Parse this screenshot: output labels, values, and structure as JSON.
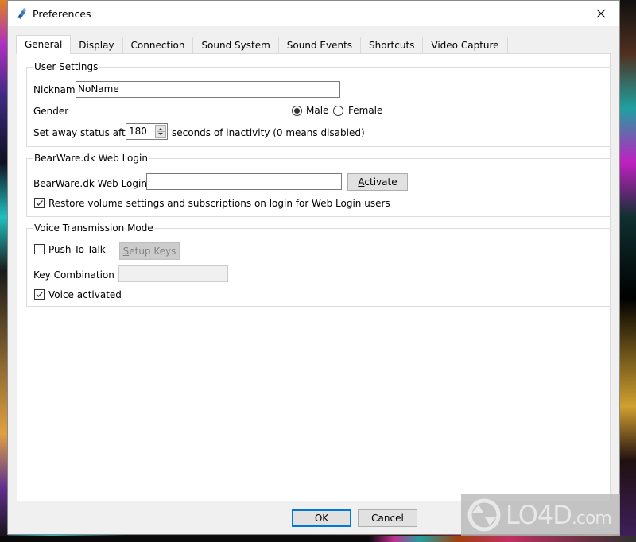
{
  "window": {
    "title": "Preferences",
    "app_icon": "teamtalk-app-icon",
    "close_icon": "close-icon"
  },
  "tabs": [
    {
      "label": "General",
      "active": true
    },
    {
      "label": "Display",
      "active": false
    },
    {
      "label": "Connection",
      "active": false
    },
    {
      "label": "Sound System",
      "active": false
    },
    {
      "label": "Sound Events",
      "active": false
    },
    {
      "label": "Shortcuts",
      "active": false
    },
    {
      "label": "Video Capture",
      "active": false
    }
  ],
  "user_settings": {
    "group_title": "User Settings",
    "nickname_label": "Nickname",
    "nickname_value": "NoName",
    "gender_label": "Gender",
    "gender_options": [
      {
        "label": "Male",
        "checked": true
      },
      {
        "label": "Female",
        "checked": false
      }
    ],
    "away_label_before": "Set away status after",
    "away_value": "180",
    "away_label_after": "seconds of inactivity (0 means disabled)"
  },
  "web_login": {
    "group_title": "BearWare.dk Web Login",
    "login_id_label": "BearWare.dk Web Login ID",
    "login_id_value": "",
    "activate_button": {
      "mnemonic": "A",
      "rest": "ctivate"
    },
    "restore_checkbox": {
      "label": "Restore volume settings and subscriptions on login for Web Login users",
      "checked": true
    }
  },
  "voice_transmission": {
    "group_title": "Voice Transmission Mode",
    "push_to_talk": {
      "label": "Push To Talk",
      "checked": false
    },
    "setup_keys_button": {
      "mnemonic": "S",
      "rest": "etup Keys",
      "enabled": false
    },
    "key_combination_label": "Key Combination",
    "key_combination_value": "",
    "voice_activated": {
      "label": "Voice activated",
      "checked": true
    }
  },
  "footer": {
    "ok_label": "OK",
    "cancel_label": "Cancel"
  },
  "watermark": {
    "text": "LO4D",
    "suffix": ".com"
  },
  "colors": {
    "accent": "#0078d7",
    "window_bg": "#f0f0f0",
    "panel_bg": "#ffffff"
  }
}
